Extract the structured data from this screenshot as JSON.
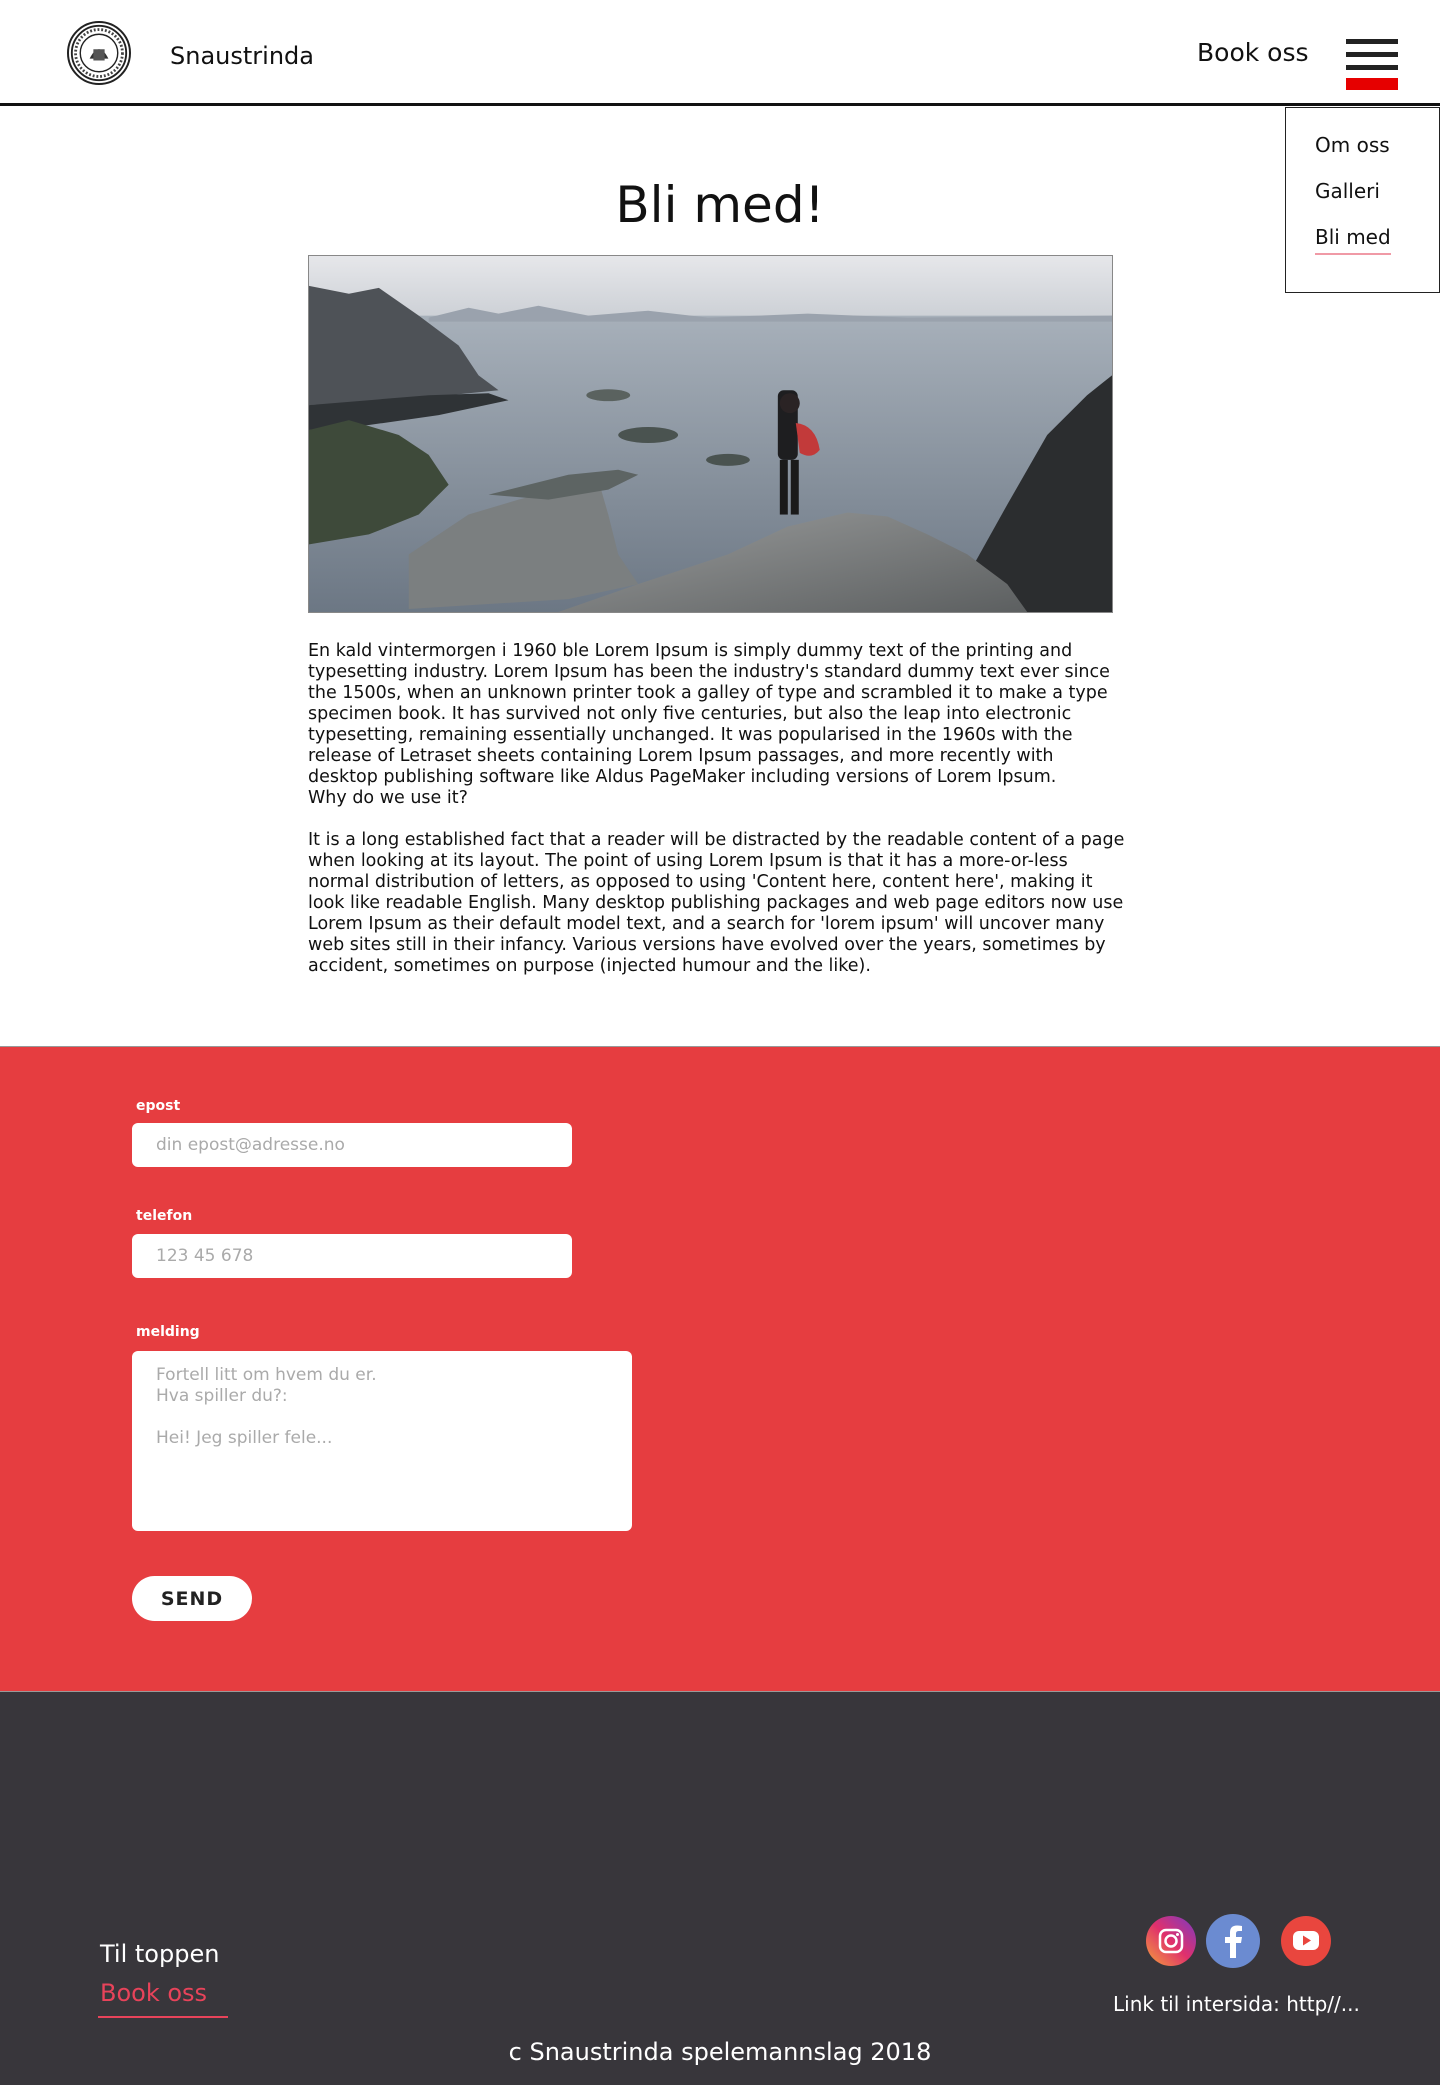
{
  "header": {
    "brand": "Snaustrinda",
    "book_link": "Book oss",
    "menu_icon": "hamburger-icon"
  },
  "menu": {
    "items": [
      {
        "label": "Om oss"
      },
      {
        "label": "Galleri"
      },
      {
        "label": "Bli med",
        "active": true
      }
    ]
  },
  "main": {
    "title": "Bli med!",
    "paragraph1": "En kald vintermorgen i 1960 ble Lorem Ipsum is simply dummy text of the printing and typesetting industry. Lorem Ipsum has been the industry's standard dummy text ever since the 1500s, when an unknown printer took a galley of type and scrambled it to make a type specimen book. It has survived not only five centuries, but also the leap into electronic typesetting, remaining essentially unchanged. It was popularised in the 1960s with the release of Letraset sheets containing Lorem Ipsum passages, and more recently with desktop publishing software like Aldus PageMaker including versions of Lorem Ipsum.",
    "question": "Why do we use it?",
    "paragraph2": "It is a long established fact that a reader will be distracted by the readable content of a page when looking at its layout. The point of using Lorem Ipsum is that it has a more-or-less normal distribution of letters, as opposed to using 'Content here, content here', making it look like readable English. Many desktop publishing packages and web page editors now use Lorem Ipsum as their default model text, and a search for 'lorem ipsum' will uncover many web sites still in their infancy. Various versions have evolved over the years, sometimes by accident, sometimes on purpose (injected humour and the like)."
  },
  "form": {
    "email_label": "epost",
    "email_placeholder": "din epost@adresse.no",
    "phone_label": "telefon",
    "phone_placeholder": "123 45 678",
    "message_label": "melding",
    "message_placeholder": "Fortell litt om hvem du er.\nHva spiller du?:\n\nHei! Jeg spiller fele...",
    "send_label": "SEND"
  },
  "footer": {
    "to_top": "Til toppen",
    "book": "Book oss",
    "social": [
      "instagram-icon",
      "facebook-icon",
      "youtube-icon"
    ],
    "link_text": "Link til intersida: http//...",
    "copyright": "c Snaustrinda spelemannslag 2018"
  },
  "colors": {
    "accent_red": "#e63d40",
    "footer_bg": "#38363b",
    "footer_link": "#e8435a"
  }
}
